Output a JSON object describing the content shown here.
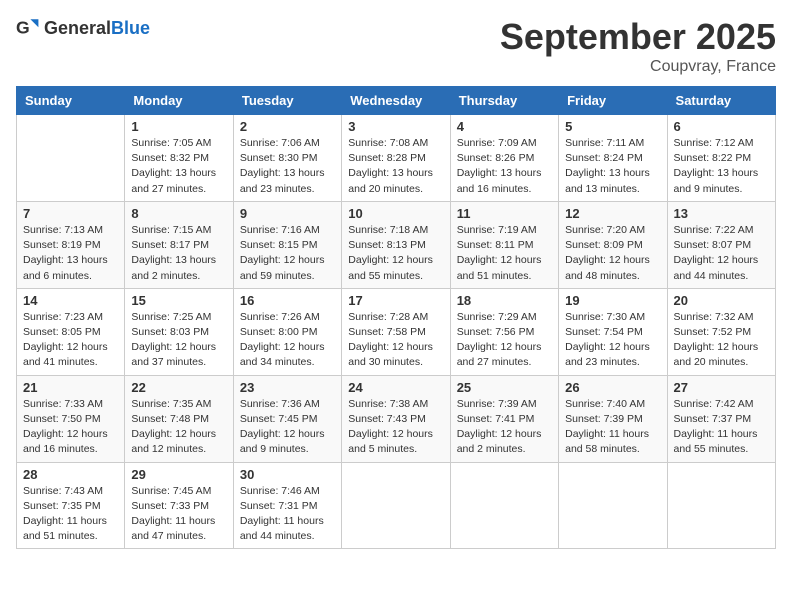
{
  "header": {
    "logo_general": "General",
    "logo_blue": "Blue",
    "month_title": "September 2025",
    "location": "Coupvray, France"
  },
  "weekdays": [
    "Sunday",
    "Monday",
    "Tuesday",
    "Wednesday",
    "Thursday",
    "Friday",
    "Saturday"
  ],
  "weeks": [
    [
      {
        "day": "",
        "info": ""
      },
      {
        "day": "1",
        "info": "Sunrise: 7:05 AM\nSunset: 8:32 PM\nDaylight: 13 hours and 27 minutes."
      },
      {
        "day": "2",
        "info": "Sunrise: 7:06 AM\nSunset: 8:30 PM\nDaylight: 13 hours and 23 minutes."
      },
      {
        "day": "3",
        "info": "Sunrise: 7:08 AM\nSunset: 8:28 PM\nDaylight: 13 hours and 20 minutes."
      },
      {
        "day": "4",
        "info": "Sunrise: 7:09 AM\nSunset: 8:26 PM\nDaylight: 13 hours and 16 minutes."
      },
      {
        "day": "5",
        "info": "Sunrise: 7:11 AM\nSunset: 8:24 PM\nDaylight: 13 hours and 13 minutes."
      },
      {
        "day": "6",
        "info": "Sunrise: 7:12 AM\nSunset: 8:22 PM\nDaylight: 13 hours and 9 minutes."
      }
    ],
    [
      {
        "day": "7",
        "info": "Sunrise: 7:13 AM\nSunset: 8:19 PM\nDaylight: 13 hours and 6 minutes."
      },
      {
        "day": "8",
        "info": "Sunrise: 7:15 AM\nSunset: 8:17 PM\nDaylight: 13 hours and 2 minutes."
      },
      {
        "day": "9",
        "info": "Sunrise: 7:16 AM\nSunset: 8:15 PM\nDaylight: 12 hours and 59 minutes."
      },
      {
        "day": "10",
        "info": "Sunrise: 7:18 AM\nSunset: 8:13 PM\nDaylight: 12 hours and 55 minutes."
      },
      {
        "day": "11",
        "info": "Sunrise: 7:19 AM\nSunset: 8:11 PM\nDaylight: 12 hours and 51 minutes."
      },
      {
        "day": "12",
        "info": "Sunrise: 7:20 AM\nSunset: 8:09 PM\nDaylight: 12 hours and 48 minutes."
      },
      {
        "day": "13",
        "info": "Sunrise: 7:22 AM\nSunset: 8:07 PM\nDaylight: 12 hours and 44 minutes."
      }
    ],
    [
      {
        "day": "14",
        "info": "Sunrise: 7:23 AM\nSunset: 8:05 PM\nDaylight: 12 hours and 41 minutes."
      },
      {
        "day": "15",
        "info": "Sunrise: 7:25 AM\nSunset: 8:03 PM\nDaylight: 12 hours and 37 minutes."
      },
      {
        "day": "16",
        "info": "Sunrise: 7:26 AM\nSunset: 8:00 PM\nDaylight: 12 hours and 34 minutes."
      },
      {
        "day": "17",
        "info": "Sunrise: 7:28 AM\nSunset: 7:58 PM\nDaylight: 12 hours and 30 minutes."
      },
      {
        "day": "18",
        "info": "Sunrise: 7:29 AM\nSunset: 7:56 PM\nDaylight: 12 hours and 27 minutes."
      },
      {
        "day": "19",
        "info": "Sunrise: 7:30 AM\nSunset: 7:54 PM\nDaylight: 12 hours and 23 minutes."
      },
      {
        "day": "20",
        "info": "Sunrise: 7:32 AM\nSunset: 7:52 PM\nDaylight: 12 hours and 20 minutes."
      }
    ],
    [
      {
        "day": "21",
        "info": "Sunrise: 7:33 AM\nSunset: 7:50 PM\nDaylight: 12 hours and 16 minutes."
      },
      {
        "day": "22",
        "info": "Sunrise: 7:35 AM\nSunset: 7:48 PM\nDaylight: 12 hours and 12 minutes."
      },
      {
        "day": "23",
        "info": "Sunrise: 7:36 AM\nSunset: 7:45 PM\nDaylight: 12 hours and 9 minutes."
      },
      {
        "day": "24",
        "info": "Sunrise: 7:38 AM\nSunset: 7:43 PM\nDaylight: 12 hours and 5 minutes."
      },
      {
        "day": "25",
        "info": "Sunrise: 7:39 AM\nSunset: 7:41 PM\nDaylight: 12 hours and 2 minutes."
      },
      {
        "day": "26",
        "info": "Sunrise: 7:40 AM\nSunset: 7:39 PM\nDaylight: 11 hours and 58 minutes."
      },
      {
        "day": "27",
        "info": "Sunrise: 7:42 AM\nSunset: 7:37 PM\nDaylight: 11 hours and 55 minutes."
      }
    ],
    [
      {
        "day": "28",
        "info": "Sunrise: 7:43 AM\nSunset: 7:35 PM\nDaylight: 11 hours and 51 minutes."
      },
      {
        "day": "29",
        "info": "Sunrise: 7:45 AM\nSunset: 7:33 PM\nDaylight: 11 hours and 47 minutes."
      },
      {
        "day": "30",
        "info": "Sunrise: 7:46 AM\nSunset: 7:31 PM\nDaylight: 11 hours and 44 minutes."
      },
      {
        "day": "",
        "info": ""
      },
      {
        "day": "",
        "info": ""
      },
      {
        "day": "",
        "info": ""
      },
      {
        "day": "",
        "info": ""
      }
    ]
  ]
}
